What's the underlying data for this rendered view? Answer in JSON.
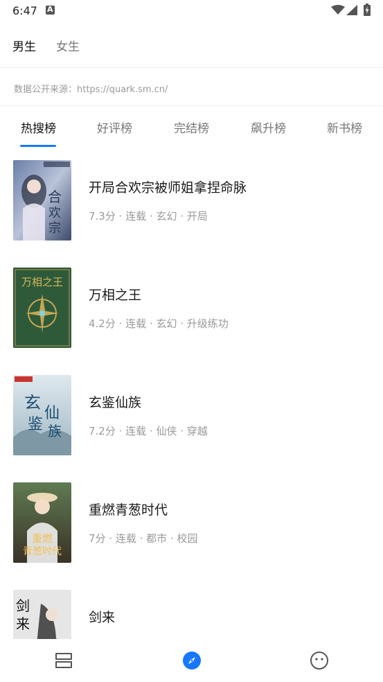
{
  "status": {
    "time": "6:47"
  },
  "gender_tabs": [
    {
      "label": "男生",
      "active": true
    },
    {
      "label": "女生",
      "active": false
    }
  ],
  "source_text": "数据公开来源：https://quark.sm.cn/",
  "rank_tabs": [
    {
      "label": "热搜榜",
      "active": true
    },
    {
      "label": "好评榜",
      "active": false
    },
    {
      "label": "完结榜",
      "active": false
    },
    {
      "label": "飙升榜",
      "active": false
    },
    {
      "label": "新书榜",
      "active": false
    }
  ],
  "books": [
    {
      "title": "开局合欢宗被师姐拿捏命脉",
      "meta": "7.3分 · 连载 · 玄幻 · 开局",
      "cover_text": "合欢宗"
    },
    {
      "title": "万相之王",
      "meta": "4.2分 · 连载 · 玄幻 · 升级练功",
      "cover_text": "万相之王"
    },
    {
      "title": "玄鉴仙族",
      "meta": "7.2分 · 连载 · 仙侠 · 穿越",
      "cover_text": "玄鉴仙族"
    },
    {
      "title": "重燃青葱时代",
      "meta": "7分 · 连载 · 都市 · 校园",
      "cover_text": "重燃青葱时代"
    },
    {
      "title": "剑来",
      "meta": "",
      "cover_text": "剑来"
    }
  ],
  "bottom_nav": [
    {
      "icon": "bookshelf-icon",
      "active": false
    },
    {
      "icon": "compass-icon",
      "active": true
    },
    {
      "icon": "smiley-icon",
      "active": false
    }
  ],
  "colors": {
    "accent": "#1677ff",
    "muted": "#9a9a9a"
  }
}
